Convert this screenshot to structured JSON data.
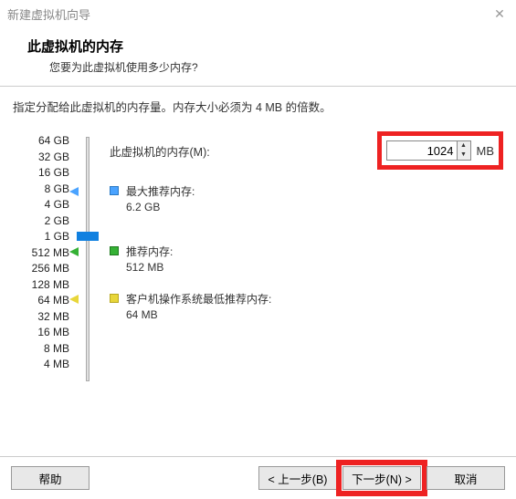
{
  "window": {
    "title": "新建虚拟机向导"
  },
  "header": {
    "title": "此虚拟机的内存",
    "subtitle": "您要为此虚拟机使用多少内存?"
  },
  "instruction": "指定分配给此虚拟机的内存量。内存大小必须为 4 MB 的倍数。",
  "memory": {
    "field_label": "此虚拟机的内存(M):",
    "value": "1024",
    "unit": "MB"
  },
  "scale": [
    "64 GB",
    "32 GB",
    "16 GB",
    "8 GB",
    "4 GB",
    "2 GB",
    "1 GB",
    "512 MB",
    "256 MB",
    "128 MB",
    "64 MB",
    "32 MB",
    "16 MB",
    "8 MB",
    "4 MB"
  ],
  "recommendations": {
    "max": {
      "label": "最大推荐内存:",
      "value": "6.2 GB",
      "color": "#4aa3ff"
    },
    "rec": {
      "label": "推荐内存:",
      "value": "512 MB",
      "color": "#35b135"
    },
    "min": {
      "label": "客户机操作系统最低推荐内存:",
      "value": "64 MB",
      "color": "#e8d63a"
    }
  },
  "buttons": {
    "help": "帮助",
    "back": "< 上一步(B)",
    "next": "下一步(N) >",
    "cancel": "取消"
  },
  "icons": {
    "close": "✕",
    "up": "▲",
    "down": "▼"
  }
}
